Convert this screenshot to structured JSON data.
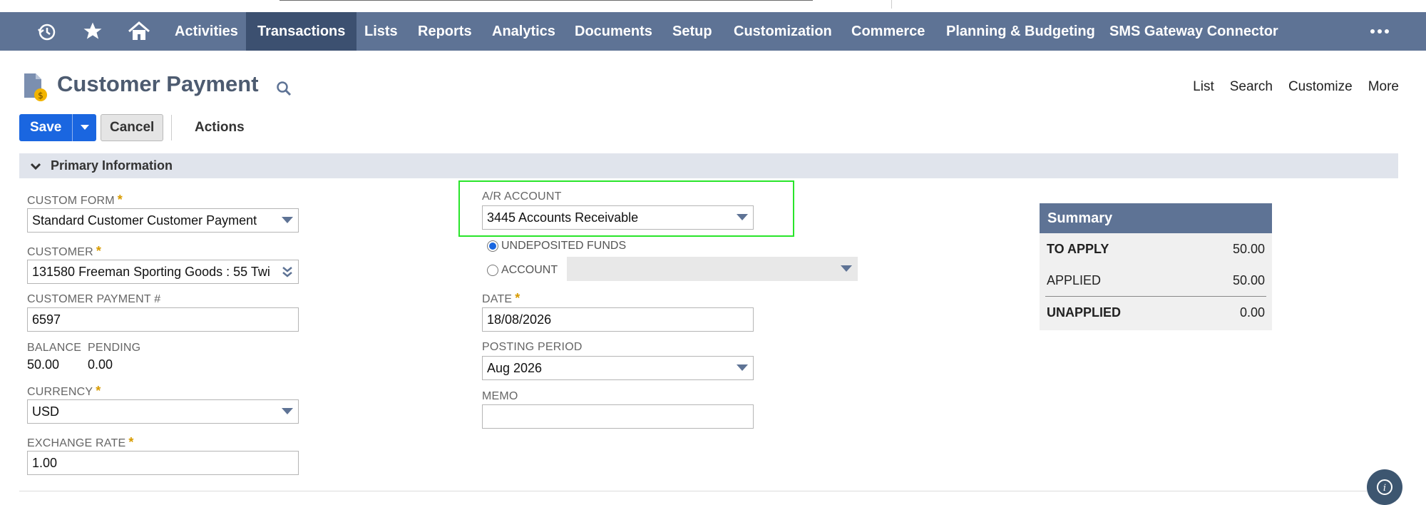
{
  "nav": {
    "items": [
      "Activities",
      "Transactions",
      "Lists",
      "Reports",
      "Analytics",
      "Documents",
      "Setup",
      "Customization",
      "Commerce",
      "Planning & Budgeting",
      "SMS Gateway Connector"
    ],
    "active": "Transactions",
    "more_label": "•••"
  },
  "page": {
    "title": "Customer Payment",
    "top_links": [
      "List",
      "Search",
      "Customize",
      "More"
    ]
  },
  "toolbar": {
    "save_label": "Save",
    "cancel_label": "Cancel",
    "actions_label": "Actions"
  },
  "section": {
    "label": "Primary Information"
  },
  "form": {
    "custom_form": {
      "label": "CUSTOM FORM",
      "value": "Standard Customer Customer Payment",
      "required": "*"
    },
    "customer": {
      "label": "CUSTOMER",
      "value": "131580 Freeman Sporting Goods : 55 Twi",
      "required": "*"
    },
    "payment_no": {
      "label": "CUSTOMER PAYMENT #",
      "value": "6597"
    },
    "balance": {
      "label": "BALANCE",
      "value": "50.00"
    },
    "pending": {
      "label": "PENDING",
      "value": "0.00"
    },
    "currency": {
      "label": "CURRENCY",
      "value": "USD",
      "required": "*"
    },
    "exchange_rate": {
      "label": "EXCHANGE RATE",
      "value": "1.00",
      "required": "*"
    },
    "ar_account": {
      "label": "A/R ACCOUNT",
      "value": "3445 Accounts Receivable"
    },
    "undeposited": {
      "label": "UNDEPOSITED FUNDS",
      "selected": true
    },
    "account": {
      "label": "ACCOUNT",
      "value": ""
    },
    "date": {
      "label": "DATE",
      "value": "18/08/2026",
      "required": "*"
    },
    "posting_period": {
      "label": "POSTING PERIOD",
      "value": "Aug 2026"
    },
    "memo": {
      "label": "MEMO",
      "value": ""
    }
  },
  "summary": {
    "title": "Summary",
    "to_apply": {
      "label": "TO APPLY",
      "value": "50.00"
    },
    "applied": {
      "label": "APPLIED",
      "value": "50.00"
    },
    "unapplied": {
      "label": "UNAPPLIED",
      "value": "0.00"
    }
  },
  "colors": {
    "nav_bg": "#5e7395",
    "nav_active": "#3c5070",
    "primary_btn": "#1a66e0",
    "highlight": "#29e52a",
    "required": "#d89b00"
  }
}
